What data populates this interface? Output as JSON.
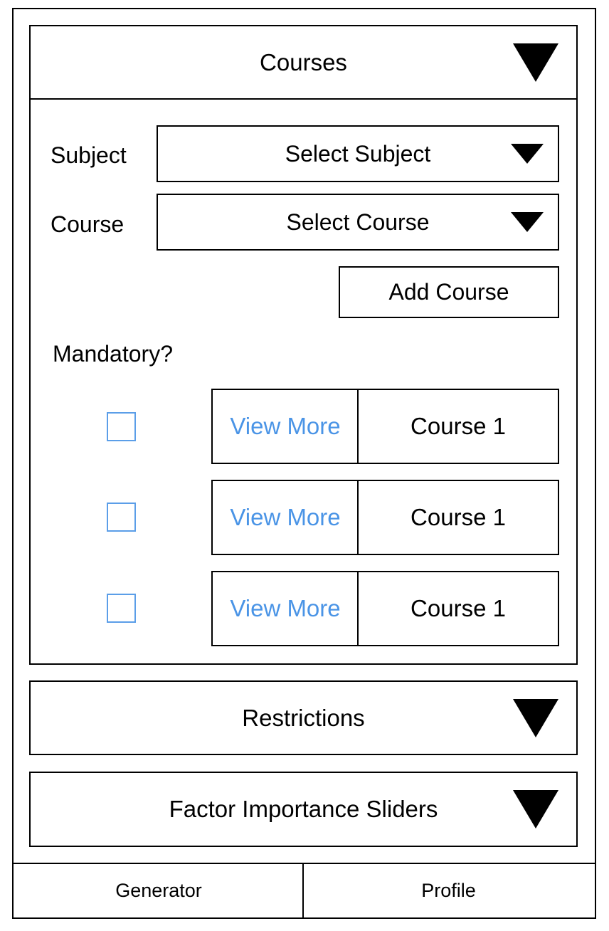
{
  "accordion": {
    "courses": {
      "title": "Courses",
      "expanded": true
    },
    "restrictions": {
      "title": "Restrictions",
      "expanded": false
    },
    "factors": {
      "title": "Factor Importance Sliders",
      "expanded": false
    }
  },
  "form": {
    "subject_label": "Subject",
    "subject_select_value": "Select Subject",
    "course_label": "Course",
    "course_select_value": "Select Course",
    "add_course_label": "Add Course",
    "mandatory_label": "Mandatory?"
  },
  "course_rows": [
    {
      "view_more": "View More",
      "name": "Course 1",
      "mandatory": false
    },
    {
      "view_more": "View More",
      "name": "Course 1",
      "mandatory": false
    },
    {
      "view_more": "View More",
      "name": "Course 1",
      "mandatory": false
    }
  ],
  "bottom_nav": {
    "tabs": [
      {
        "label": "Generator"
      },
      {
        "label": "Profile"
      }
    ]
  },
  "colors": {
    "link": "#4a94e6",
    "checkbox_border": "#5b9ee8",
    "border": "#000000"
  },
  "icons": {
    "expand": "chevron-down-icon",
    "dropdown": "caret-down-icon",
    "checkbox": "checkbox-icon"
  }
}
